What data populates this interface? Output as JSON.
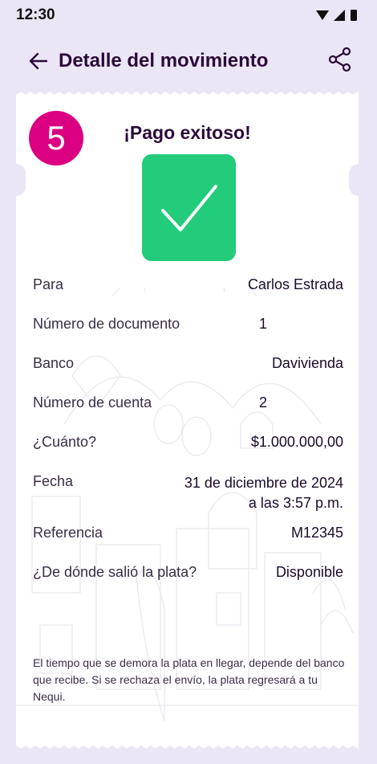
{
  "status": {
    "time": "12:30"
  },
  "header": {
    "title": "Detalle del movimiento"
  },
  "receipt": {
    "step": "5",
    "title": "¡Pago exitoso!",
    "details": [
      {
        "label": "Para",
        "value": "Carlos Estrada"
      },
      {
        "label": "Número de documento",
        "value": "1"
      },
      {
        "label": "Banco",
        "value": "Davivienda"
      },
      {
        "label": "Número de cuenta",
        "value": "2"
      },
      {
        "label": "¿Cuánto?",
        "value": "$1.000.000,00"
      },
      {
        "label": "Fecha",
        "value": "31 de diciembre de 2024",
        "value2": "a las 3:57 p.m."
      },
      {
        "label": "Referencia",
        "value": "M12345"
      },
      {
        "label": "¿De dónde salió la plata?",
        "value": "Disponible"
      }
    ],
    "footnote": "El tiempo que se demora la plata en llegar, depende del banco que recibe. Si se rechaza el envío, la plata regresará a tu Nequi."
  },
  "colors": {
    "accent": "#da0081",
    "success": "#22cc7a",
    "background": "#ebe6f6",
    "text": "#2b0b3a"
  },
  "icons": [
    "back-arrow-icon",
    "share-icon",
    "checkmark-icon",
    "wifi-icon",
    "signal-icon",
    "battery-icon"
  ]
}
